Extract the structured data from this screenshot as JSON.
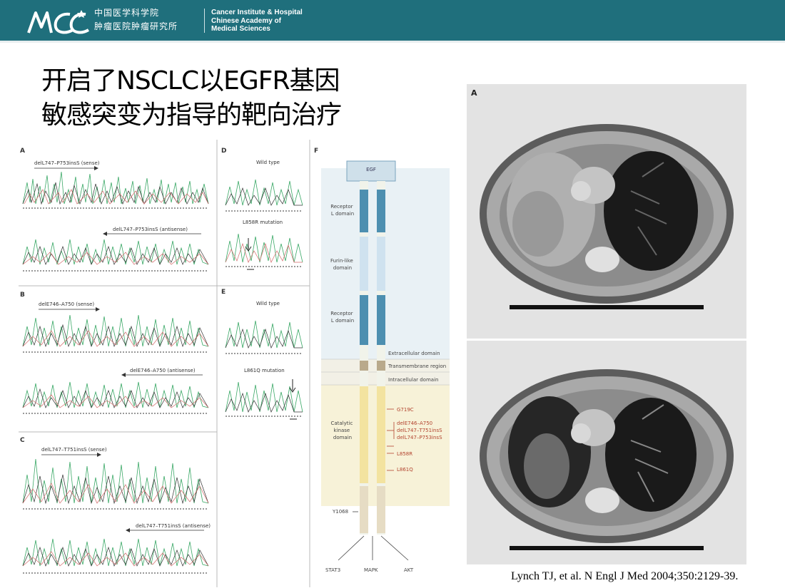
{
  "header": {
    "inst_cn_line1": "中国医学科学院",
    "inst_cn_line2": "肿瘤医院肿瘤研究所",
    "inst_en": [
      "Cancer Institute & Hospital",
      "Chinese Academy of",
      "Medical Sciences"
    ],
    "brand_color": "#1f6f7c"
  },
  "title": {
    "line1": "开启了NSCLC以EGFR基因",
    "line2": "敏感突变为指导的靶向治疗"
  },
  "figure": {
    "panels": {
      "A": {
        "letter": "A",
        "label_sense": "delL747–P753insS (sense)",
        "label_antisense": "delL747–P753insS (antisense)"
      },
      "B": {
        "letter": "B",
        "label_sense": "delE746–A750 (sense)",
        "label_antisense": "delE746–A750 (antisense)"
      },
      "C": {
        "letter": "C",
        "label_sense": "delL747–T751insS (sense)",
        "label_antisense": "delL747–T751insS (antisense)"
      },
      "D": {
        "letter": "D",
        "wild": "Wild type",
        "mutation": "L858R mutation"
      },
      "E": {
        "letter": "E",
        "wild": "Wild type",
        "mutation": "L861Q mutation"
      },
      "F": {
        "letter": "F"
      }
    },
    "egfr": {
      "egf": "EGF",
      "domains": {
        "receptor1": [
          "Receptor",
          "L domain"
        ],
        "furin": [
          "Furin-like",
          "domain"
        ],
        "receptor2": [
          "Receptor",
          "L domain"
        ],
        "catalytic": [
          "Catalytic",
          "kinase",
          "domain"
        ]
      },
      "regions": [
        "Extracellular domain",
        "Transmembrane region",
        "Intracellular domain"
      ],
      "mutations": [
        "G719C",
        "delE746–A750",
        "delL747–T751insS",
        "delL747–P753insS",
        "L858R",
        "L861Q"
      ],
      "site": "Y1068",
      "pathways": [
        "STAT3",
        "MAPK",
        "AKT"
      ]
    }
  },
  "ct": {
    "label_top": "A"
  },
  "reference": "Lynch TJ, et al. N Engl J Med 2004;350:2129-39."
}
